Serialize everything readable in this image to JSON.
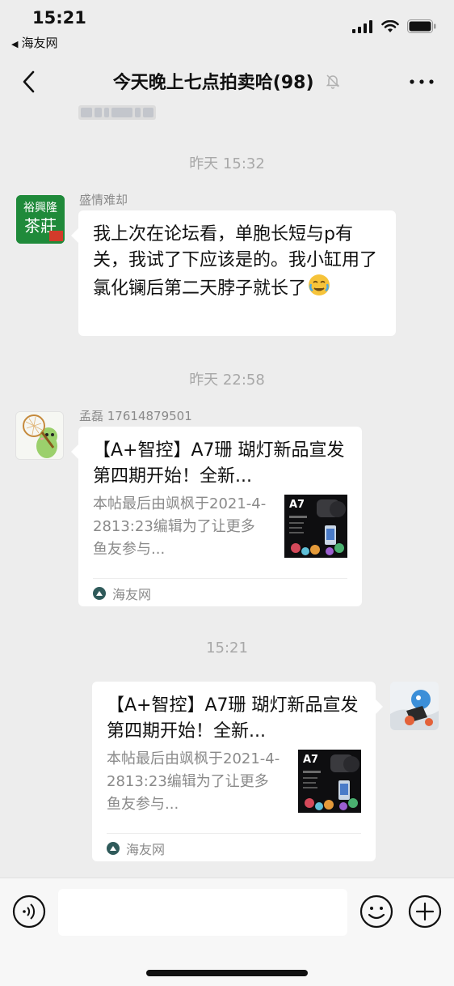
{
  "status_bar": {
    "time": "15:21",
    "back_app": "海友网"
  },
  "nav": {
    "title": "今天晚上七点拍卖哈(98)"
  },
  "messages": [
    {
      "timestamp": "昨天 15:32"
    },
    {
      "sender": "盛情难却",
      "text": "我上次在论坛看，单胞长短与p有关，我试了下应该是的。我小缸用了氯化镧后第二天脖子就长了"
    },
    {
      "timestamp": "昨天 22:58"
    },
    {
      "sender": "孟磊 17614879501",
      "link": {
        "title": "【A+智控】A7珊 瑚灯新品宣发  第四期开始！全新...",
        "desc": "本帖最后由飒枫于2021-4-2813:23编辑为了让更多鱼友参与...",
        "thumb_text": "A7",
        "source": "海友网"
      }
    },
    {
      "timestamp": "15:21"
    },
    {
      "self": true,
      "link": {
        "title": "【A+智控】A7珊 瑚灯新品宣发  第四期开始！全新...",
        "desc": "本帖最后由飒枫于2021-4-2813:23编辑为了让更多鱼友参与...",
        "thumb_text": "A7",
        "source": "海友网"
      }
    }
  ],
  "avatar_texts": {
    "tea_top": "裕興隆",
    "tea_main": "茶莊"
  },
  "colors": {
    "background": "#ededed",
    "bubble": "#ffffff",
    "timestamp": "#a8a8a8",
    "tea_green": "#1f8a3a"
  },
  "icons": {
    "voice": "voice-icon",
    "emoji": "emoji-icon",
    "plus": "plus-icon",
    "back": "chevron-left-icon",
    "more": "more-icon",
    "mute": "bell-off-icon"
  }
}
